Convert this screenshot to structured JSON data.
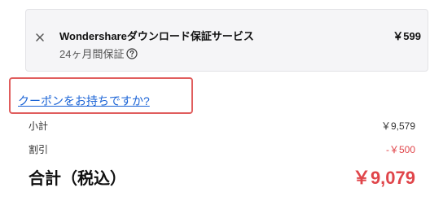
{
  "service": {
    "title": "Wondershareダウンロード保証サービス",
    "price": "￥599",
    "subtitle": "24ヶ月間保証"
  },
  "coupon": {
    "link_label": "クーポンをお持ちですか?"
  },
  "summary": {
    "subtotal_label": "小計",
    "subtotal_value": "￥9,579",
    "discount_label": "割引",
    "discount_value": "-￥500",
    "total_label": "合計（税込）",
    "total_value": "￥9,079"
  },
  "colors": {
    "accent_red": "#e0454a",
    "link_blue": "#1a63d6",
    "highlight_border": "#e05d5d"
  },
  "icons": {
    "remove": "close-icon",
    "help": "question-circle-icon"
  }
}
